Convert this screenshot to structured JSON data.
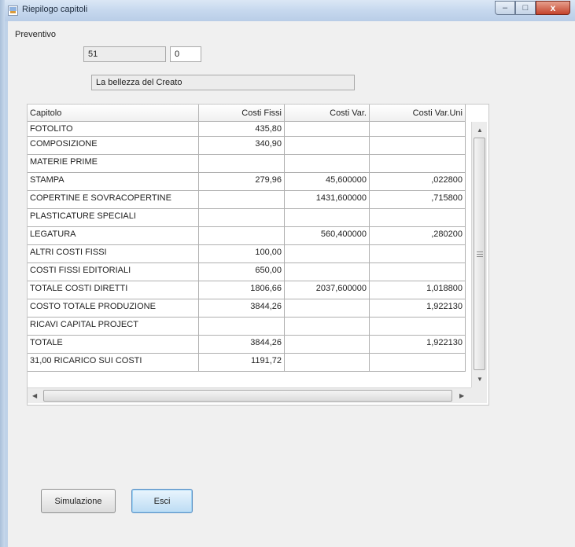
{
  "window": {
    "title": "Riepilogo capitoli",
    "buttons": {
      "minimize": "–",
      "maximize": "□",
      "close": "x"
    }
  },
  "form": {
    "preventivo_label": "Preventivo",
    "preventivo_number": "51",
    "preventivo_version": "0",
    "description": "La bellezza del Creato"
  },
  "table": {
    "columns": [
      "Capitolo",
      "Costi Fissi",
      "Costi Var.",
      "Costi Var.Uni"
    ],
    "rows": [
      [
        "FOTOLITO",
        "435,80",
        "",
        ""
      ],
      [
        "COMPOSIZIONE",
        "340,90",
        "",
        ""
      ],
      [
        "MATERIE PRIME",
        "",
        "",
        ""
      ],
      [
        "STAMPA",
        "279,96",
        "45,600000",
        ",022800"
      ],
      [
        "COPERTINE E SOVRACOPERTINE",
        "",
        "1431,600000",
        ",715800"
      ],
      [
        "PLASTICATURE SPECIALI",
        "",
        "",
        ""
      ],
      [
        "LEGATURA",
        "",
        "560,400000",
        ",280200"
      ],
      [
        "ALTRI COSTI FISSI",
        "100,00",
        "",
        ""
      ],
      [
        "COSTI FISSI EDITORIALI",
        "650,00",
        "",
        ""
      ],
      [
        "TOTALE COSTI DIRETTI",
        "1806,66",
        "2037,600000",
        "1,018800"
      ],
      [
        "COSTO TOTALE PRODUZIONE",
        "3844,26",
        "",
        "1,922130"
      ],
      [
        "RICAVI CAPITAL PROJECT",
        "",
        "",
        ""
      ],
      [
        "TOTALE",
        "3844,26",
        "",
        "1,922130"
      ],
      [
        "31,00 RICARICO SUI COSTI",
        "1191,72",
        "",
        ""
      ]
    ]
  },
  "buttons": {
    "simulazione": "Simulazione",
    "esci": "Esci"
  }
}
